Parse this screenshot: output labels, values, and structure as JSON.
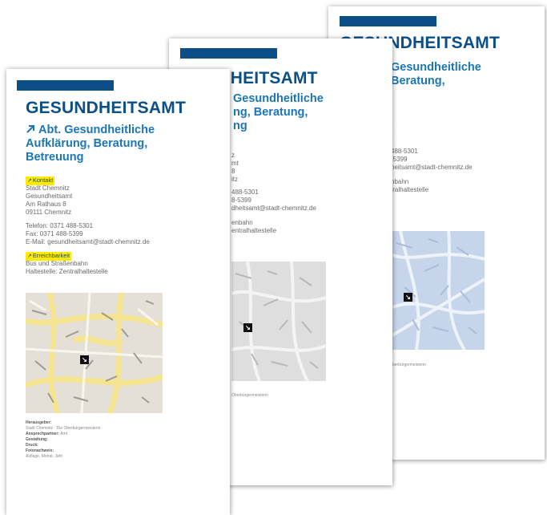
{
  "pages": {
    "back": {
      "title": "GESUNDHEITSAMT",
      "subtitle_lines": [
        "Gesundheitliche",
        "Beratung,"
      ],
      "frag_lines": [
        "",
        "",
        "",
        "",
        "",
        "t",
        "t",
        "",
        "488-5301",
        "-5399",
        "heitsamt@stadt-chemnitz.de",
        "",
        "",
        "nbahn",
        "tralhaltestelle"
      ],
      "footer": "berbürgermeisterin"
    },
    "middle": {
      "title": "NDHEITSAMT",
      "subtitle_lines": [
        "Gesundheitliche",
        "ng, Beratung,",
        "ng"
      ],
      "frag_lines": [
        "z",
        "mt",
        "8",
        "itz",
        "",
        "488-5301",
        "8-5399",
        "dheitsamt@stadt-chemnitz.de",
        "",
        "",
        "enbahn",
        "entralhaltestelle"
      ],
      "footer": "Oberbürgermeisterin"
    },
    "front": {
      "title": "GESUNDHEITSAMT",
      "subtitle_lines": [
        "Abt. Gesundheitliche",
        "Aufklärung, Beratung,",
        "Betreuung"
      ],
      "contact_tag": "Kontakt",
      "address_lines": [
        "Stadt Chemnitz",
        "Gesundheitsamt",
        "Am Rathaus 8",
        "09111 Chemnitz"
      ],
      "phone": "Telefon: 0371 488-5301",
      "fax": "Fax: 0371 488-5399",
      "email": "E-Mail: gesundheitsamt@stadt-chemnitz.de",
      "access_tag": "Erreichbarkeit",
      "access_lines": [
        "Bus und Straßenbahn",
        "Haltestelle: Zentralhaltestelle"
      ],
      "imprint": {
        "publisher_label": "Herausgeber:",
        "publisher": "Stadt Chemnitz · Die Oberbürgermeisterin",
        "contact_label": "Ansprechpartner:",
        "contact": "Amt",
        "design_label": "Gestaltung:",
        "print_label": "Druck:",
        "photo_label": "Fotonachweis:",
        "edition": "Auflage, Monat, Jahr"
      }
    }
  },
  "colors": {
    "brand_dark": "#0b4f86",
    "brand_light": "#1b76b6",
    "highlight": "#ffeb00"
  },
  "icons": {
    "arrow": "arrow-up-right-icon",
    "map_marker": "map-marker-icon"
  }
}
